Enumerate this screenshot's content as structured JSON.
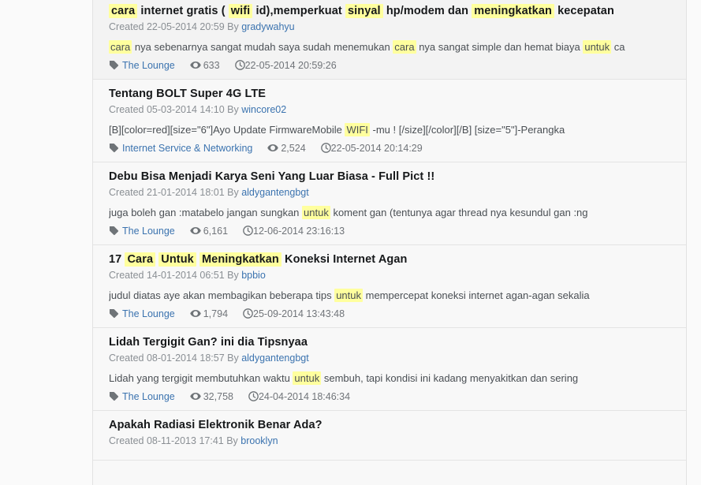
{
  "page": {
    "kind": "forum-search-results",
    "highlight_color": "#ffff9e",
    "link_color": "#3b73af",
    "row_bg": "#f8f8f8",
    "row_bg_alt": "#f3f3f3",
    "created_label": "Created",
    "by_label": "By"
  },
  "icons": {
    "tag": "tag-icon",
    "views": "eye-icon",
    "time": "clock-icon"
  },
  "results": [
    {
      "title_parts": [
        {
          "t": "cara",
          "hl": true
        },
        {
          "t": " internet gratis ( ",
          "hl": false
        },
        {
          "t": "wifi",
          "hl": true
        },
        {
          "t": " id),memperkuat ",
          "hl": false
        },
        {
          "t": "sinyal",
          "hl": true
        },
        {
          "t": " hp/modem dan ",
          "hl": false
        },
        {
          "t": "meningkatkan",
          "hl": true
        },
        {
          "t": " kecepatan",
          "hl": false
        }
      ],
      "title_plain": "cara internet gratis ( wifi id),memperkuat sinyal hp/modem dan meningkatkan kecepatan",
      "created_date": "22-05-2014 20:59",
      "author": "gradywahyu",
      "snippet_parts": [
        {
          "t": "cara",
          "hl": true
        },
        {
          "t": " nya sebenarnya sangat mudah saya sudah menemukan ",
          "hl": false
        },
        {
          "t": "cara",
          "hl": true
        },
        {
          "t": " nya sangat simple dan hemat biaya ",
          "hl": false
        },
        {
          "t": "untuk",
          "hl": true
        },
        {
          "t": " ca",
          "hl": false
        }
      ],
      "forum": "The Lounge",
      "views": "633",
      "timestamp": "22-05-2014 20:59:26"
    },
    {
      "title_parts": [
        {
          "t": "Tentang BOLT Super 4G LTE",
          "hl": false
        }
      ],
      "title_plain": "Tentang BOLT Super 4G LTE",
      "created_date": "05-03-2014 14:10",
      "author": "wincore02",
      "snippet_parts": [
        {
          "t": "[B][color=red][size=\"6\"]Ayo Update FirmwareMobile ",
          "hl": false
        },
        {
          "t": "WIFI",
          "hl": true
        },
        {
          "t": " -mu ! [/size][/color][/B] [size=\"5\"]-Perangka",
          "hl": false
        }
      ],
      "forum": "Internet Service & Networking",
      "views": "2,524",
      "timestamp": "22-05-2014 20:14:29"
    },
    {
      "title_parts": [
        {
          "t": "Debu Bisa Menjadi Karya Seni Yang Luar Biasa - Full Pict !!",
          "hl": false
        }
      ],
      "title_plain": "Debu Bisa Menjadi Karya Seni Yang Luar Biasa - Full Pict !!",
      "created_date": "21-01-2014 18:01",
      "author": "aldygantengbgt",
      "snippet_parts": [
        {
          "t": "juga boleh gan :matabelo jangan sungkan ",
          "hl": false
        },
        {
          "t": "untuk",
          "hl": true
        },
        {
          "t": " koment gan (tentunya agar thread nya kesundul gan :ng",
          "hl": false
        }
      ],
      "forum": "The Lounge",
      "views": "6,161",
      "timestamp": "12-06-2014 23:16:13"
    },
    {
      "title_parts": [
        {
          "t": "17 ",
          "hl": false
        },
        {
          "t": "Cara",
          "hl": true
        },
        {
          "t": " ",
          "hl": false
        },
        {
          "t": "Untuk",
          "hl": true
        },
        {
          "t": " ",
          "hl": false
        },
        {
          "t": "Meningkatkan",
          "hl": true
        },
        {
          "t": " Koneksi Internet Agan",
          "hl": false
        }
      ],
      "title_plain": "17 Cara Untuk Meningkatkan Koneksi Internet Agan",
      "created_date": "14-01-2014 06:51",
      "author": "bpbio",
      "snippet_parts": [
        {
          "t": "judul diatas aye akan membagikan beberapa tips ",
          "hl": false
        },
        {
          "t": "untuk",
          "hl": true
        },
        {
          "t": " mempercepat koneksi internet agan-agan sekalia",
          "hl": false
        }
      ],
      "forum": "The Lounge",
      "views": "1,794",
      "timestamp": "25-09-2014 13:43:48"
    },
    {
      "title_parts": [
        {
          "t": "Lidah Tergigit Gan? ini dia Tipsnyaa",
          "hl": false
        }
      ],
      "title_plain": "Lidah Tergigit Gan? ini dia Tipsnyaa",
      "created_date": "08-01-2014 18:57",
      "author": "aldygantengbgt",
      "snippet_parts": [
        {
          "t": "Lidah yang tergigit membutuhkan waktu ",
          "hl": false
        },
        {
          "t": "untuk",
          "hl": true
        },
        {
          "t": " sembuh, tapi kondisi ini kadang menyakitkan dan sering",
          "hl": false
        }
      ],
      "forum": "The Lounge",
      "views": "32,758",
      "timestamp": "24-04-2014 18:46:34"
    },
    {
      "title_parts": [
        {
          "t": "Apakah Radiasi Elektronik Benar Ada?",
          "hl": false
        }
      ],
      "title_plain": "Apakah Radiasi Elektronik Benar Ada?",
      "created_date": "08-11-2013 17:41",
      "author": "brooklyn",
      "snippet_parts": [],
      "forum": "",
      "views": "",
      "timestamp": "",
      "clipped": true
    }
  ]
}
